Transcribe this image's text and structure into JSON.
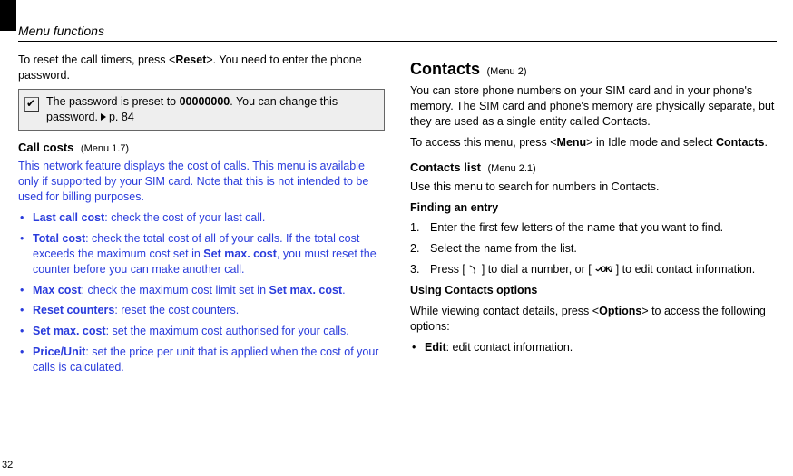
{
  "header": {
    "title": "Menu functions"
  },
  "page_number": "32",
  "left": {
    "intro_before": "To reset the call timers, press <",
    "intro_reset": "Reset",
    "intro_after": ">. You need to enter the phone password.",
    "note_before": "The password is preset to ",
    "note_bold": "00000000",
    "note_after": ". You can change this password.",
    "note_ref": "p. 84",
    "section_title": "Call costs",
    "section_sub": "(Menu 1.7)",
    "section_desc": "This network feature displays the cost of calls. This menu is available only if supported by your SIM card. Note that this is not intended to be used for billing purposes.",
    "bullets": [
      {
        "label": "Last call cost",
        "desc": ": check the cost of your last call."
      },
      {
        "label": "Total cost",
        "desc": ": check the total cost of all of your calls. If the total cost exceeds the maximum cost set in ",
        "bold2": "Set max. cost",
        "desc2": ", you must reset the counter before you can make another call."
      },
      {
        "label": "Max cost",
        "desc": ": check the maximum cost limit set in ",
        "bold2": "Set max. cost",
        "desc2": "."
      },
      {
        "label": "Reset counters",
        "desc": ": reset the cost counters."
      },
      {
        "label": "Set max. cost",
        "desc": ": set the maximum cost authorised for your calls."
      },
      {
        "label": "Price/Unit",
        "desc": ": set the price per unit that is applied when the cost of your calls is calculated."
      }
    ]
  },
  "right": {
    "h1_title": "Contacts",
    "h1_sub": "(Menu 2)",
    "p1": "You can store phone numbers on your SIM card and in your phone's memory. The SIM card and phone's memory are physically separate, but they are used as a single entity called Contacts.",
    "p2_a": "To access this menu, press <",
    "p2_b": "Menu",
    "p2_c": "> in Idle mode and select ",
    "p2_d": "Contacts",
    "p2_e": ".",
    "h2_title": "Contacts list",
    "h2_sub": "(Menu 2.1)",
    "p3": "Use this menu to search for numbers in Contacts.",
    "h3_title": "Finding an entry",
    "ol": [
      {
        "n": "1.",
        "t": "Enter the first few letters of the name that you want to find."
      },
      {
        "n": "2.",
        "t": "Select the name from the list."
      },
      {
        "n": "3.",
        "t_a": "Press [ ",
        "t_b": " ] to dial a number, or [ ",
        "t_c": " ] to edit contact information."
      }
    ],
    "h4_title": "Using Contacts options",
    "p4_a": "While viewing contact details, press <",
    "p4_b": "Options",
    "p4_c": "> to access the following options:",
    "bullet": {
      "label": "Edit",
      "desc": ": edit contact information."
    }
  }
}
